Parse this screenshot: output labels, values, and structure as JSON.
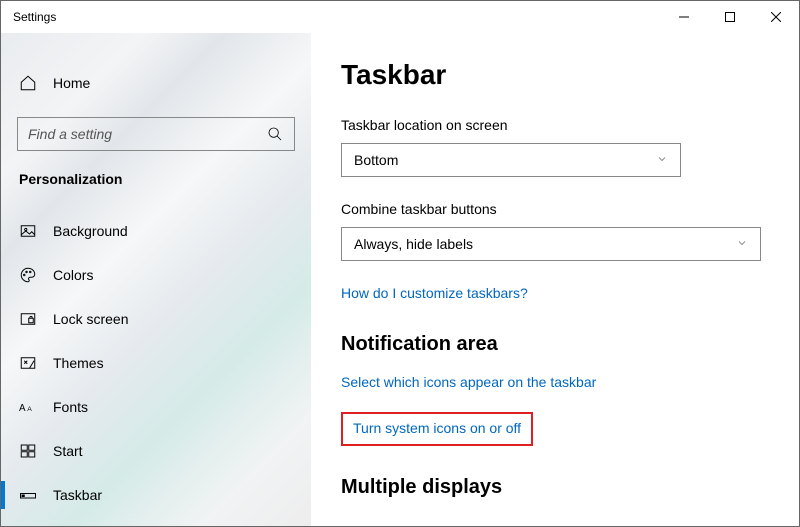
{
  "window": {
    "title": "Settings"
  },
  "sidebar": {
    "home_label": "Home",
    "search_placeholder": "Find a setting",
    "category": "Personalization",
    "items": [
      {
        "label": "Background"
      },
      {
        "label": "Colors"
      },
      {
        "label": "Lock screen"
      },
      {
        "label": "Themes"
      },
      {
        "label": "Fonts"
      },
      {
        "label": "Start"
      },
      {
        "label": "Taskbar"
      }
    ]
  },
  "main": {
    "heading": "Taskbar",
    "location_label": "Taskbar location on screen",
    "location_value": "Bottom",
    "combine_label": "Combine taskbar buttons",
    "combine_value": "Always, hide labels",
    "link_customize": "How do I customize taskbars?",
    "section_notification": "Notification area",
    "link_select_icons": "Select which icons appear on the taskbar",
    "link_system_icons": "Turn system icons on or off",
    "section_multiple": "Multiple displays"
  }
}
